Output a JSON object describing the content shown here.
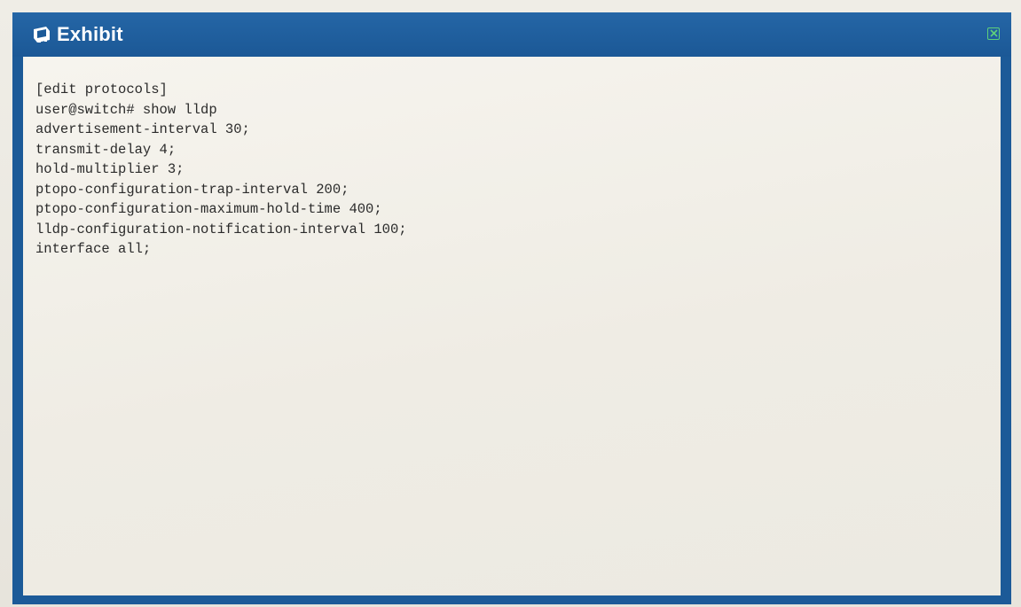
{
  "window": {
    "title": "Exhibit",
    "icon": "monitor-icon",
    "close_icon": "close-icon",
    "colors": {
      "titlebar": "#1c5a98",
      "content_bg": "#f2f0ea",
      "close_accent": "#5fd07a"
    }
  },
  "code": {
    "lines": [
      "[edit protocols]",
      "user@switch# show lldp",
      "advertisement-interval 30;",
      "transmit-delay 4;",
      "hold-multiplier 3;",
      "ptopo-configuration-trap-interval 200;",
      "ptopo-configuration-maximum-hold-time 400;",
      "lldp-configuration-notification-interval 100;",
      "interface all;"
    ]
  }
}
